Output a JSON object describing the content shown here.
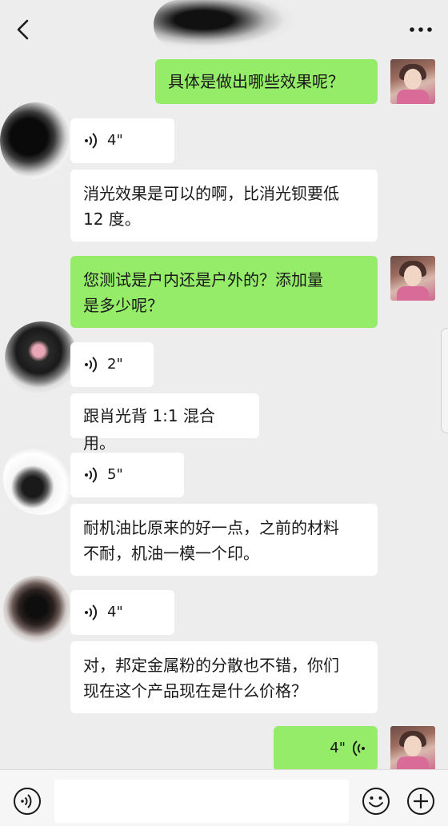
{
  "header": {
    "title": ""
  },
  "messages": [
    {
      "from": "me",
      "type": "text",
      "text": "具体是做出哪些效果呢？"
    },
    {
      "from": "other",
      "type": "voice",
      "duration": "4\""
    },
    {
      "from": "other",
      "type": "text",
      "lines": [
        "消光效果是可以的啊，比消光钡要低",
        "12 度。"
      ]
    },
    {
      "from": "me",
      "type": "text",
      "lines": [
        "您测试是户内还是户外的？添加量",
        "是多少呢？"
      ]
    },
    {
      "from": "other",
      "type": "voice",
      "duration": "2\""
    },
    {
      "from": "other",
      "type": "text",
      "text": "跟肖光背 1:1 混合用。"
    },
    {
      "from": "other",
      "type": "voice",
      "duration": "5\""
    },
    {
      "from": "other",
      "type": "text",
      "lines": [
        "耐机油比原来的好一点，之前的材料",
        "不耐，机油一模一个印。"
      ]
    },
    {
      "from": "other",
      "type": "voice",
      "duration": "4\""
    },
    {
      "from": "other",
      "type": "text",
      "lines": [
        "对，邦定金属粉的分散也不错，你们",
        "现在这个产品现在是什么价格？"
      ]
    },
    {
      "from": "me",
      "type": "voice",
      "duration": "4\""
    }
  ],
  "input": {
    "value": "",
    "placeholder": ""
  },
  "colors": {
    "background": "#ededed",
    "my_bubble": "#95ec69",
    "their_bubble": "#ffffff"
  },
  "icons": {
    "back": "chevron-left-icon",
    "more": "more-dots-icon",
    "voice_toggle": "voice-mode-icon",
    "emoji": "emoji-icon",
    "plus": "plus-circle-icon"
  }
}
